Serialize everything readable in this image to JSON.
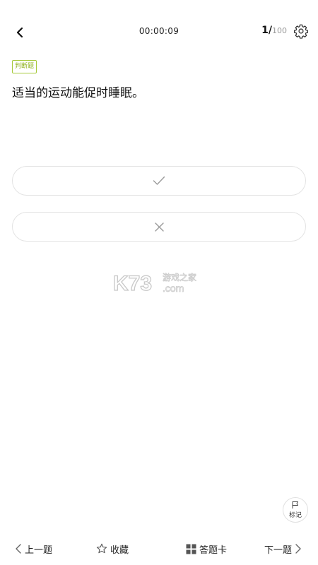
{
  "header": {
    "timer": "00:00:09",
    "current": "1/",
    "total": "100",
    "back_icon": "chevron-left-icon",
    "settings_icon": "gear-icon"
  },
  "question": {
    "type_label": "判断题",
    "text": "适当的运动能促时睡眠。"
  },
  "options": {
    "true_icon": "check-icon",
    "false_icon": "cross-icon"
  },
  "watermark": {
    "brand": "K73",
    "cn_text": "游戏之家",
    "domain": ".com"
  },
  "mark": {
    "label": "标记",
    "icon": "flag-icon"
  },
  "bottom_bar": {
    "prev_label": "上一题",
    "favorite_label": "收藏",
    "card_label": "答题卡",
    "next_label": "下一题"
  },
  "colors": {
    "accent": "#8fb21f",
    "border": "#e3e3e3"
  }
}
